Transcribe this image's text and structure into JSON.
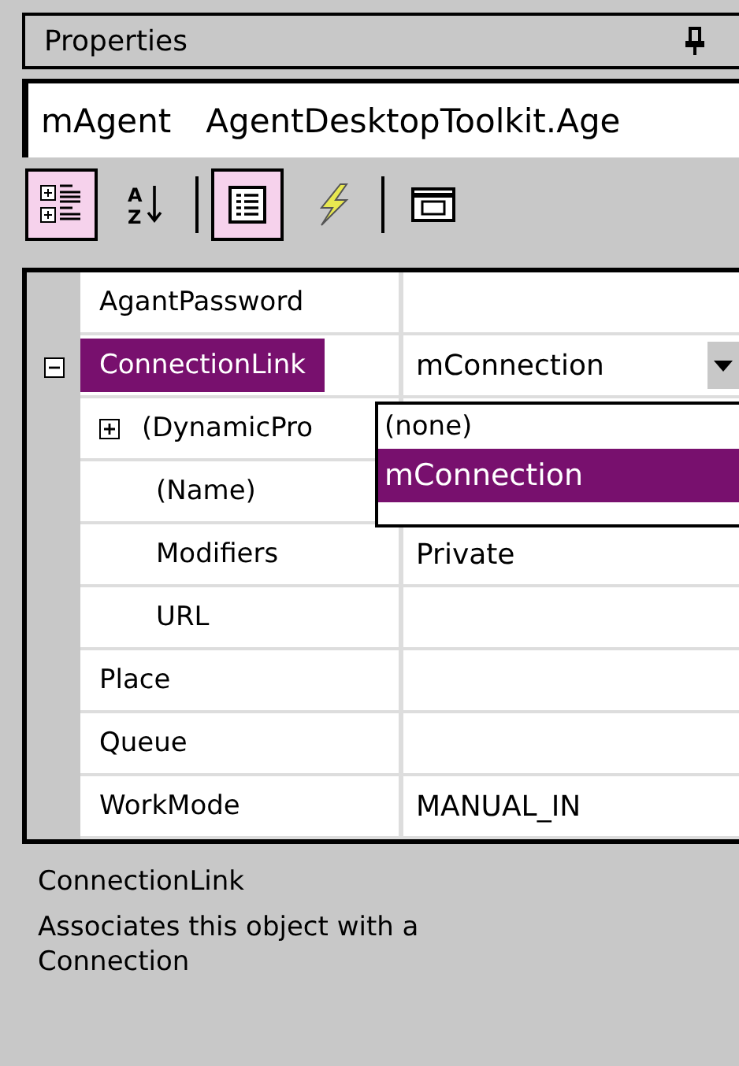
{
  "panel": {
    "title": "Properties"
  },
  "object_selector": {
    "name": "mAgent",
    "type": "AgentDesktopToolkit.Age"
  },
  "toolbar": [
    {
      "kind": "categorized",
      "selected": true
    },
    {
      "kind": "alphabetical",
      "selected": false,
      "letters": [
        "A",
        "Z"
      ]
    },
    {
      "kind": "separator"
    },
    {
      "kind": "properties",
      "selected": true
    },
    {
      "kind": "events",
      "selected": false
    },
    {
      "kind": "separator"
    },
    {
      "kind": "property-pages",
      "selected": false
    }
  ],
  "grid": {
    "rows": [
      {
        "name": "AgantPassword",
        "selected": false
      },
      {
        "name": "ConnectionLink",
        "value": "mConnection",
        "selected": true,
        "expanded": true,
        "has_dropdown": true,
        "children": [
          {
            "name": "(DynamicPro",
            "selected": false,
            "expanded": false
          },
          {
            "name": "(Name)",
            "selected": false
          },
          {
            "name": "Modifiers",
            "value": "Private",
            "selected": false
          },
          {
            "name": "URL",
            "selected": false
          }
        ]
      },
      {
        "name": "Place",
        "selected": false
      },
      {
        "name": "Queue",
        "selected": false
      },
      {
        "name": "WorkMode",
        "value": "MANUAL_IN",
        "selected": false
      }
    ]
  },
  "dropdown": {
    "options": [
      {
        "label": "(none)",
        "selected": false
      },
      {
        "label": "mConnection",
        "selected": true
      }
    ]
  },
  "description": {
    "title": "ConnectionLink",
    "text": "Associates this object with a Connection"
  }
}
